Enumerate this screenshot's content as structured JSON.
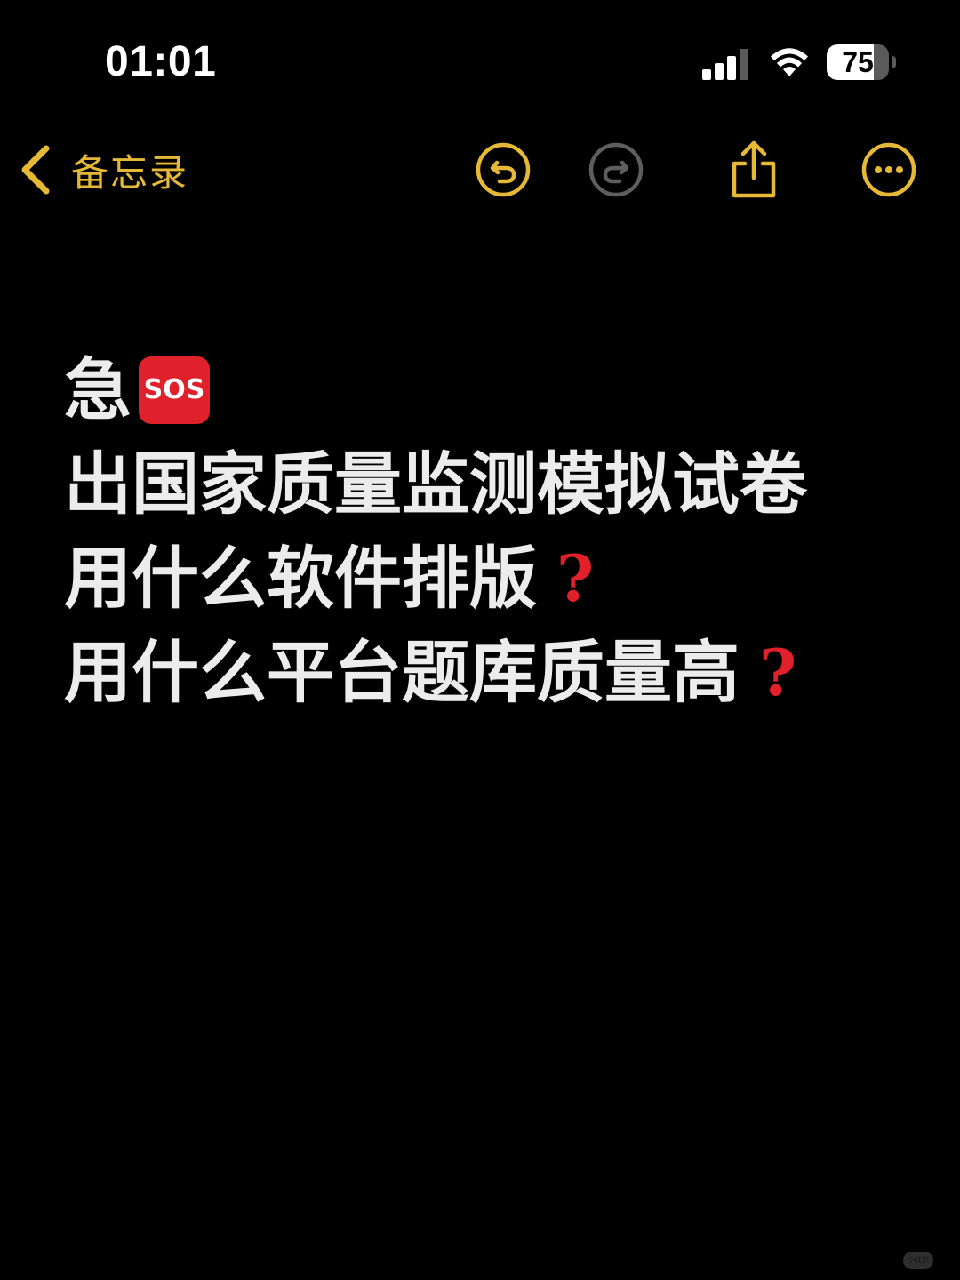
{
  "status_bar": {
    "time": "01:01",
    "signal_icon": "cellular-signal-icon",
    "wifi_icon": "wifi-icon",
    "battery_level": "75",
    "battery_fraction": 0.75
  },
  "nav": {
    "back_label": "备忘录",
    "accent_color": "#e5b836",
    "icons": {
      "back": "chevron-left-icon",
      "undo": "undo-icon",
      "redo": "redo-icon",
      "share": "share-icon",
      "more": "more-icon"
    }
  },
  "note": {
    "lines": [
      {
        "text": "急",
        "badge": "SOS"
      },
      {
        "text": "出国家质量监测模拟试卷"
      },
      {
        "text": "用什么软件排版",
        "mark": "?"
      },
      {
        "text": "用什么平台题库质量高",
        "mark": "?"
      }
    ],
    "text_color": "#ececec",
    "mark_color": "#e0202a"
  },
  "watermark": "小红书"
}
